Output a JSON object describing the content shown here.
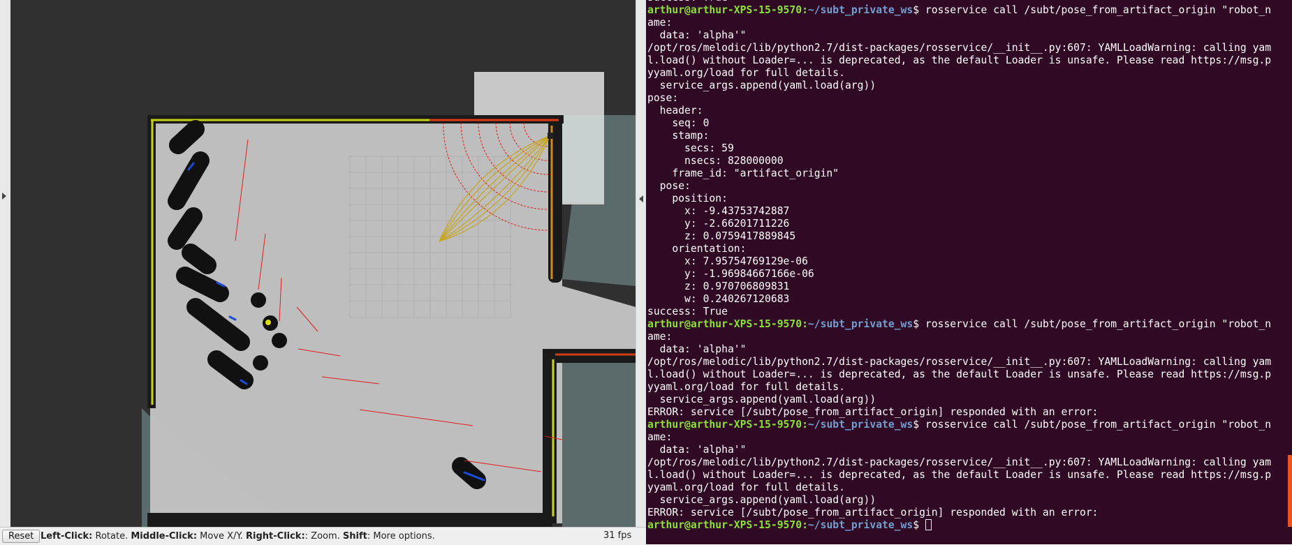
{
  "rviz": {
    "reset_label": "Reset",
    "help": {
      "left_click": "Left-Click:",
      "left_click_desc": " Rotate. ",
      "middle_click": "Middle-Click:",
      "middle_click_desc": " Move X/Y. ",
      "right_click": "Right-Click:",
      "right_click_desc": ": Zoom. ",
      "shift": "Shift",
      "shift_desc": ": More options."
    },
    "fps": "31 fps"
  },
  "terminal": {
    "lines": [
      {
        "text": "success: True"
      },
      {
        "user": "arthur@arthur-XPS-15-9570",
        "path": "~/subt_private_ws",
        "cmd": "$ rosservice call /subt/pose_from_artifact_origin \"robot_n"
      },
      {
        "text": "ame:"
      },
      {
        "text": "  data: 'alpha'\""
      },
      {
        "text": "/opt/ros/melodic/lib/python2.7/dist-packages/rosservice/__init__.py:607: YAMLLoadWarning: calling yam"
      },
      {
        "text": "l.load() without Loader=... is deprecated, as the default Loader is unsafe. Please read https://msg.p"
      },
      {
        "text": "yyaml.org/load for full details."
      },
      {
        "text": "  service_args.append(yaml.load(arg))"
      },
      {
        "text": "pose:"
      },
      {
        "text": "  header:"
      },
      {
        "text": "    seq: 0"
      },
      {
        "text": "    stamp:"
      },
      {
        "text": "      secs: 59"
      },
      {
        "text": "      nsecs: 828000000"
      },
      {
        "text": "    frame_id: \"artifact_origin\""
      },
      {
        "text": "  pose:"
      },
      {
        "text": "    position:"
      },
      {
        "text": "      x: -9.43753742887"
      },
      {
        "text": "      y: -2.66201711226"
      },
      {
        "text": "      z: 0.0759417889845"
      },
      {
        "text": "    orientation:"
      },
      {
        "text": "      x: 7.95754769129e-06"
      },
      {
        "text": "      y: -1.96984667166e-06"
      },
      {
        "text": "      z: 0.970706809831"
      },
      {
        "text": "      w: 0.240267120683"
      },
      {
        "text": "success: True"
      },
      {
        "user": "arthur@arthur-XPS-15-9570",
        "path": "~/subt_private_ws",
        "cmd": "$ rosservice call /subt/pose_from_artifact_origin \"robot_n"
      },
      {
        "text": "ame:"
      },
      {
        "text": "  data: 'alpha'\""
      },
      {
        "text": "/opt/ros/melodic/lib/python2.7/dist-packages/rosservice/__init__.py:607: YAMLLoadWarning: calling yam"
      },
      {
        "text": "l.load() without Loader=... is deprecated, as the default Loader is unsafe. Please read https://msg.p"
      },
      {
        "text": "yyaml.org/load for full details."
      },
      {
        "text": "  service_args.append(yaml.load(arg))"
      },
      {
        "text": "ERROR: service [/subt/pose_from_artifact_origin] responded with an error:"
      },
      {
        "user": "arthur@arthur-XPS-15-9570",
        "path": "~/subt_private_ws",
        "cmd": "$ rosservice call /subt/pose_from_artifact_origin \"robot_n"
      },
      {
        "text": "ame:"
      },
      {
        "text": "  data: 'alpha'\""
      },
      {
        "text": "/opt/ros/melodic/lib/python2.7/dist-packages/rosservice/__init__.py:607: YAMLLoadWarning: calling yam"
      },
      {
        "text": "l.load() without Loader=... is deprecated, as the default Loader is unsafe. Please read https://msg.p"
      },
      {
        "text": "yyaml.org/load for full details."
      },
      {
        "text": "  service_args.append(yaml.load(arg))"
      },
      {
        "text": "ERROR: service [/subt/pose_from_artifact_origin] responded with an error:"
      },
      {
        "user": "arthur@arthur-XPS-15-9570",
        "path": "~/subt_private_ws",
        "cmd": "$ ",
        "cursor": true
      }
    ]
  }
}
